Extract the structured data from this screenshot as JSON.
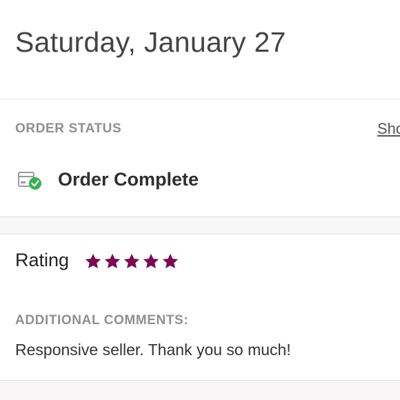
{
  "header": {
    "date": "Saturday, January 27"
  },
  "order_status": {
    "label": "ORDER STATUS",
    "link_text": "Sho",
    "status": "Order Complete",
    "icon": "package-check-icon",
    "icon_check_color": "#3cb054"
  },
  "rating": {
    "label": "Rating",
    "stars": 5,
    "max_stars": 5,
    "star_color": "#7a0a52",
    "icon": "star-icon"
  },
  "comments": {
    "label": "ADDITIONAL COMMENTS:",
    "text": "Responsive seller. Thank you so much!"
  }
}
